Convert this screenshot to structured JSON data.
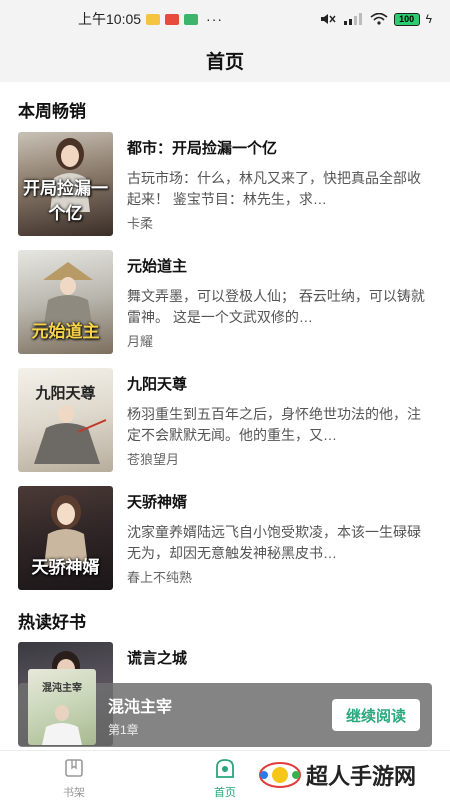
{
  "status_bar": {
    "time": "上午10:05",
    "battery": "100",
    "dots": "···"
  },
  "header": {
    "title": "首页"
  },
  "sections": {
    "weekly": "本周畅销",
    "hot": "热读好书"
  },
  "books": [
    {
      "title": "都市：开局捡漏一个亿",
      "desc": "古玩市场：什么，林凡又来了，快把真品全部收起来！ 鉴宝节目：林先生，求…",
      "author": "卡柔",
      "cover_text": "开局捡漏一个亿"
    },
    {
      "title": "元始道主",
      "desc": "舞文弄墨，可以登极人仙； 吞云吐纳，可以铸就雷神。 这是一个文武双修的…",
      "author": "月耀",
      "cover_text": "元始道主"
    },
    {
      "title": "九阳天尊",
      "desc": "杨羽重生到五百年之后，身怀绝世功法的他，注定不会默默无闻。他的重生，又…",
      "author": "苍狼望月",
      "cover_text": "九阳天尊"
    },
    {
      "title": "天骄神婿",
      "desc": "沈家童养婿陆远飞自小饱受欺凌，本该一生碌碌无为，却因无意触发神秘黑皮书…",
      "author": "春上不纯熟",
      "cover_text": "天骄神婿"
    }
  ],
  "hot_book": {
    "title": "谎言之城"
  },
  "mini_player": {
    "title": "混沌主宰",
    "chapter": "第1章",
    "cover_text": "混沌主宰",
    "button": "继续阅读"
  },
  "tabs": [
    {
      "label": "书架",
      "icon": "bookshelf-icon"
    },
    {
      "label": "首页",
      "icon": "home-icon"
    }
  ],
  "watermark": "超人手游网",
  "colors": {
    "accent": "#27a57c",
    "header_bg": "#f3f3f3"
  }
}
